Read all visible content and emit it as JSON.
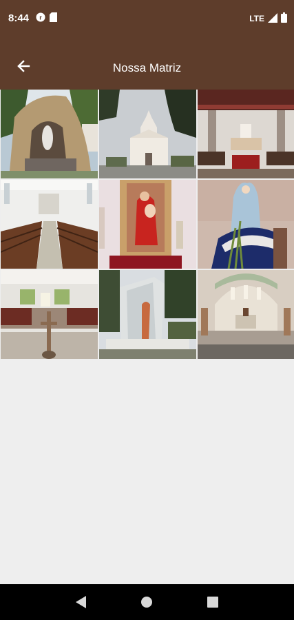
{
  "status_bar": {
    "time": "8:44",
    "network": "LTE",
    "icons": [
      "notification-app-icon",
      "sd-card-icon",
      "signal-icon",
      "battery-icon"
    ]
  },
  "app_bar": {
    "title": "Nossa Matriz",
    "back_icon": "arrow-left-icon"
  },
  "gallery": {
    "photos": [
      {
        "subject": "grotto-shrine"
      },
      {
        "subject": "church-facade"
      },
      {
        "subject": "church-altar-interior"
      },
      {
        "subject": "church-nave-pews"
      },
      {
        "subject": "saint-statue-red"
      },
      {
        "subject": "virgin-mary-statue"
      },
      {
        "subject": "church-interior-crucifix"
      },
      {
        "subject": "glass-shrine-statue"
      },
      {
        "subject": "main-altar"
      }
    ]
  },
  "nav_bar": {
    "buttons": [
      "back-triangle-icon",
      "home-circle-icon",
      "recents-square-icon"
    ]
  },
  "colors": {
    "primary": "#5e3d2b",
    "background": "#eeeeee",
    "nav": "#000000"
  }
}
